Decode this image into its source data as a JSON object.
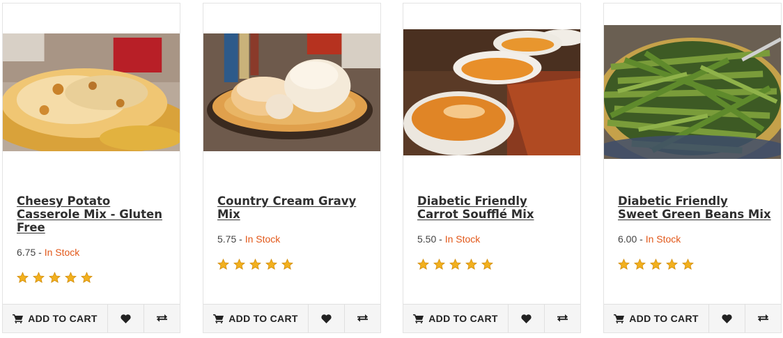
{
  "products": [
    {
      "title": "Cheesy Potato Casserole Mix - Gluten Free",
      "price": "6.75",
      "separator": " - ",
      "stock": "In Stock",
      "rating": 5,
      "add_to_cart": "ADD TO CART",
      "image_icon": "casserole-photo"
    },
    {
      "title": "Country Cream Gravy Mix",
      "price": "5.75",
      "separator": " - ",
      "stock": "In Stock",
      "rating": 5,
      "add_to_cart": "ADD TO CART",
      "image_icon": "biscuits-gravy-photo"
    },
    {
      "title": "Diabetic Friendly Carrot Soufflé Mix",
      "price": "5.50",
      "separator": " - ",
      "stock": "In Stock",
      "rating": 5,
      "add_to_cart": "ADD TO CART",
      "image_icon": "carrot-souffle-photo"
    },
    {
      "title": "Diabetic Friendly Sweet Green Beans Mix",
      "price": "6.00",
      "separator": " - ",
      "stock": "In Stock",
      "rating": 5,
      "add_to_cart": "ADD TO CART",
      "image_icon": "green-beans-photo"
    }
  ],
  "colors": {
    "stock": "#e2581a",
    "star": "#f2b01e",
    "footer_bg": "#f5f5f5"
  },
  "icons": {
    "cart": "cart-icon",
    "wishlist": "heart-icon",
    "compare": "compare-arrows-icon",
    "rating": "star-icon"
  }
}
